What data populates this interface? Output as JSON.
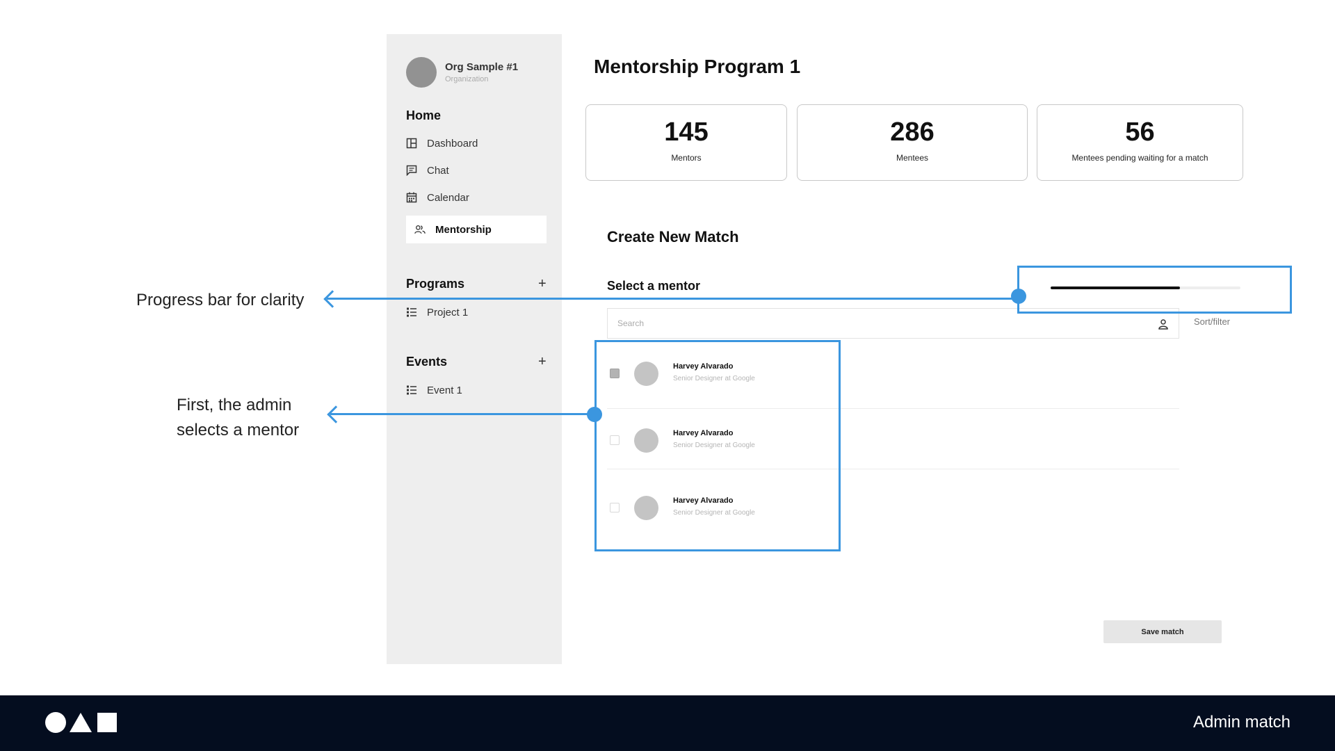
{
  "sidebar": {
    "org": {
      "name": "Org Sample #1",
      "subtitle": "Organization"
    },
    "home": {
      "title": "Home",
      "items": [
        {
          "label": "Dashboard",
          "icon": "dashboard-icon"
        },
        {
          "label": "Chat",
          "icon": "chat-icon"
        },
        {
          "label": "Calendar",
          "icon": "calendar-icon"
        },
        {
          "label": "Mentorship",
          "icon": "mentorship-icon",
          "active": true
        }
      ]
    },
    "programs": {
      "title": "Programs",
      "add_icon": "plus-icon",
      "items": [
        {
          "label": "Project 1",
          "icon": "list-icon"
        }
      ]
    },
    "events": {
      "title": "Events",
      "add_icon": "plus-icon",
      "items": [
        {
          "label": "Event 1",
          "icon": "list-icon"
        }
      ]
    }
  },
  "main": {
    "title": "Mentorship Program 1",
    "stats": [
      {
        "value": "145",
        "label": "Mentors"
      },
      {
        "value": "286",
        "label": "Mentees"
      },
      {
        "value": "56",
        "label": "Mentees pending waiting for a match"
      }
    ],
    "create_title": "Create New Match",
    "select_title": "Select a mentor",
    "progress": 0.68,
    "search": {
      "placeholder": "Search",
      "icon": "user-icon"
    },
    "sort_label": "Sort/filter",
    "mentors": [
      {
        "name": "Harvey Alvarado",
        "role": "Senior Designer at Google",
        "checked": true
      },
      {
        "name": "Harvey Alvarado",
        "role": "Senior Designer at Google",
        "checked": false
      },
      {
        "name": "Harvey Alvarado",
        "role": "Senior Designer at Google",
        "checked": false
      }
    ],
    "save_label": "Save match"
  },
  "annotations": {
    "progress_note": "Progress bar for clarity",
    "select_note_line1": "First, the admin",
    "select_note_line2": "selects a mentor"
  },
  "footer": {
    "label": "Admin match"
  },
  "colors": {
    "accent": "#3b96df",
    "footer_bg": "#040d1f",
    "sidebar_bg": "#eeeeee"
  }
}
